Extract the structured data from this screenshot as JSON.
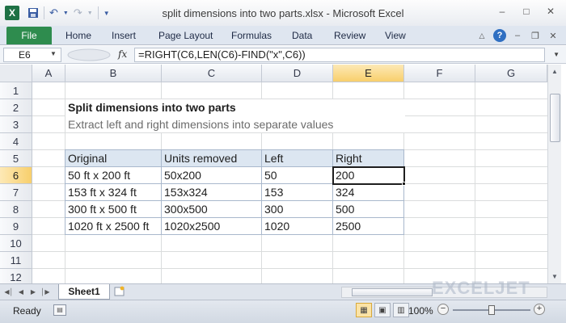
{
  "window": {
    "title": "split dimensions into two parts.xlsx - Microsoft Excel",
    "app_icon_letter": "X",
    "qat_icons": [
      "save-icon",
      "undo-icon",
      "redo-icon",
      "customize-icon"
    ],
    "controls": [
      "minimize-icon",
      "maximize-icon",
      "close-icon"
    ]
  },
  "ribbon": {
    "file_label": "File",
    "tabs": [
      "Home",
      "Insert",
      "Page Layout",
      "Formulas",
      "Data",
      "Review",
      "View"
    ],
    "right_icons": [
      "minimize-ribbon-icon",
      "help-icon",
      "workbook-minimize-icon",
      "workbook-restore-icon",
      "workbook-close-icon"
    ]
  },
  "formula_bar": {
    "name_box": "E6",
    "fx": "fx",
    "formula": "=RIGHT(C6,LEN(C6)-FIND(\"x\",C6))"
  },
  "grid": {
    "columns": [
      "A",
      "B",
      "C",
      "D",
      "E",
      "F",
      "G"
    ],
    "rows": [
      "1",
      "2",
      "3",
      "4",
      "5",
      "6",
      "7",
      "8",
      "9",
      "10",
      "11",
      "12"
    ],
    "active_column": "E",
    "active_row": "6",
    "title": "Split dimensions into two parts",
    "subtitle": "Extract left and right dimensions into separate values",
    "table": {
      "headers": [
        "Original",
        "Units removed",
        "Left",
        "Right"
      ],
      "rows": [
        [
          "50 ft x 200 ft",
          "50x200",
          "50",
          "200"
        ],
        [
          "153 ft x 324 ft",
          "153x324",
          "153",
          "324"
        ],
        [
          "300 ft x 500 ft",
          "300x500",
          "300",
          "500"
        ],
        [
          "1020 ft x 2500 ft",
          "1020x2500",
          "1020",
          "2500"
        ]
      ]
    }
  },
  "sheet_tabs": {
    "tabs": [
      "Sheet1"
    ],
    "active": "Sheet1",
    "nav_icons": [
      "first-sheet-icon",
      "prev-sheet-icon",
      "next-sheet-icon",
      "last-sheet-icon"
    ]
  },
  "watermark": "EXCELJET",
  "status_bar": {
    "status": "Ready",
    "zoom": "100%",
    "zoom_level": 1.0,
    "views": [
      "normal-view-icon",
      "page-layout-view-icon",
      "page-break-view-icon"
    ]
  },
  "colors": {
    "file_tab": "#2e8c4e",
    "table_header_fill": "#dce6f1",
    "active_header": "#f8cf6c"
  }
}
